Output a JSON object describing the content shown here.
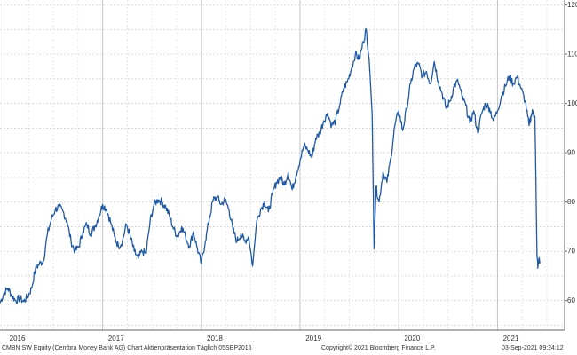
{
  "chart_data": {
    "type": "line",
    "title": "",
    "xlabel": "",
    "ylabel": "",
    "x_tick_labels": [
      "2016",
      "2017",
      "2018",
      "2019",
      "2020",
      "2021"
    ],
    "y_ticks": [
      60,
      70,
      80,
      90,
      100,
      110,
      120
    ],
    "ylim": [
      54,
      121
    ],
    "xlim": [
      2015.96,
      2021.68
    ],
    "grid": true,
    "y_axis_side": "right",
    "series": [
      {
        "name": "",
        "color": "#1f5aa6",
        "points": [
          [
            2015.96,
            59.5
          ],
          [
            2016.0,
            61.5
          ],
          [
            2016.04,
            62.5
          ],
          [
            2016.08,
            61.0
          ],
          [
            2016.12,
            60.0
          ],
          [
            2016.16,
            60.5
          ],
          [
            2016.2,
            59.8
          ],
          [
            2016.24,
            60.8
          ],
          [
            2016.28,
            62.5
          ],
          [
            2016.32,
            66.5
          ],
          [
            2016.36,
            67.5
          ],
          [
            2016.4,
            68.0
          ],
          [
            2016.44,
            73.5
          ],
          [
            2016.48,
            76.5
          ],
          [
            2016.52,
            78.5
          ],
          [
            2016.56,
            79.0
          ],
          [
            2016.6,
            78.0
          ],
          [
            2016.64,
            76.0
          ],
          [
            2016.68,
            72.0
          ],
          [
            2016.72,
            70.0
          ],
          [
            2016.76,
            71.0
          ],
          [
            2016.8,
            74.0
          ],
          [
            2016.84,
            75.5
          ],
          [
            2016.88,
            73.5
          ],
          [
            2016.92,
            75.0
          ],
          [
            2016.96,
            77.0
          ],
          [
            2017.0,
            79.5
          ],
          [
            2017.04,
            78.5
          ],
          [
            2017.08,
            76.0
          ],
          [
            2017.12,
            73.0
          ],
          [
            2017.16,
            71.0
          ],
          [
            2017.2,
            72.0
          ],
          [
            2017.24,
            75.5
          ],
          [
            2017.28,
            73.0
          ],
          [
            2017.32,
            70.0
          ],
          [
            2017.36,
            68.5
          ],
          [
            2017.4,
            70.0
          ],
          [
            2017.44,
            69.5
          ],
          [
            2017.48,
            76.0
          ],
          [
            2017.52,
            79.5
          ],
          [
            2017.56,
            80.5
          ],
          [
            2017.6,
            80.0
          ],
          [
            2017.64,
            79.0
          ],
          [
            2017.68,
            77.0
          ],
          [
            2017.72,
            74.5
          ],
          [
            2017.76,
            73.0
          ],
          [
            2017.8,
            75.0
          ],
          [
            2017.84,
            73.0
          ],
          [
            2017.88,
            71.0
          ],
          [
            2017.92,
            74.0
          ],
          [
            2017.96,
            70.5
          ],
          [
            2018.0,
            67.5
          ],
          [
            2018.04,
            72.0
          ],
          [
            2018.08,
            76.5
          ],
          [
            2018.12,
            80.5
          ],
          [
            2018.16,
            81.0
          ],
          [
            2018.2,
            79.5
          ],
          [
            2018.24,
            80.5
          ],
          [
            2018.28,
            78.5
          ],
          [
            2018.32,
            74.5
          ],
          [
            2018.36,
            72.0
          ],
          [
            2018.4,
            73.5
          ],
          [
            2018.44,
            72.0
          ],
          [
            2018.48,
            73.0
          ],
          [
            2018.52,
            67.0
          ],
          [
            2018.56,
            76.0
          ],
          [
            2018.6,
            78.5
          ],
          [
            2018.64,
            80.0
          ],
          [
            2018.68,
            78.0
          ],
          [
            2018.72,
            81.5
          ],
          [
            2018.76,
            84.0
          ],
          [
            2018.8,
            85.0
          ],
          [
            2018.84,
            83.5
          ],
          [
            2018.88,
            86.0
          ],
          [
            2018.92,
            82.5
          ],
          [
            2018.96,
            85.5
          ],
          [
            2019.0,
            88.5
          ],
          [
            2019.04,
            91.5
          ],
          [
            2019.08,
            90.5
          ],
          [
            2019.12,
            89.0
          ],
          [
            2019.16,
            93.0
          ],
          [
            2019.2,
            94.0
          ],
          [
            2019.24,
            96.5
          ],
          [
            2019.28,
            98.0
          ],
          [
            2019.32,
            95.5
          ],
          [
            2019.36,
            96.5
          ],
          [
            2019.4,
            99.5
          ],
          [
            2019.44,
            103.0
          ],
          [
            2019.48,
            104.5
          ],
          [
            2019.52,
            107.0
          ],
          [
            2019.56,
            110.0
          ],
          [
            2019.6,
            109.0
          ],
          [
            2019.64,
            112.5
          ],
          [
            2019.67,
            115.0
          ],
          [
            2019.7,
            109.0
          ],
          [
            2019.73,
            98.0
          ],
          [
            2019.75,
            70.5
          ],
          [
            2019.77,
            83.0
          ],
          [
            2019.8,
            80.0
          ],
          [
            2019.84,
            86.0
          ],
          [
            2019.88,
            84.0
          ],
          [
            2019.92,
            89.0
          ],
          [
            2019.96,
            95.5
          ],
          [
            2020.0,
            98.5
          ],
          [
            2020.04,
            94.5
          ],
          [
            2020.08,
            99.0
          ],
          [
            2020.12,
            104.0
          ],
          [
            2020.16,
            107.5
          ],
          [
            2020.2,
            108.0
          ],
          [
            2020.24,
            105.5
          ],
          [
            2020.28,
            106.5
          ],
          [
            2020.32,
            104.0
          ],
          [
            2020.36,
            108.5
          ],
          [
            2020.4,
            104.5
          ],
          [
            2020.44,
            102.0
          ],
          [
            2020.48,
            99.0
          ],
          [
            2020.52,
            100.5
          ],
          [
            2020.56,
            103.5
          ],
          [
            2020.6,
            104.5
          ],
          [
            2020.64,
            101.5
          ],
          [
            2020.68,
            99.5
          ],
          [
            2020.72,
            96.0
          ],
          [
            2020.76,
            98.5
          ],
          [
            2020.8,
            94.0
          ],
          [
            2020.84,
            98.0
          ],
          [
            2020.88,
            100.0
          ],
          [
            2020.92,
            99.0
          ],
          [
            2020.96,
            96.5
          ],
          [
            2021.0,
            98.5
          ],
          [
            2021.04,
            101.5
          ],
          [
            2021.08,
            103.5
          ],
          [
            2021.12,
            105.5
          ],
          [
            2021.16,
            104.0
          ],
          [
            2021.2,
            105.5
          ],
          [
            2021.24,
            103.0
          ],
          [
            2021.28,
            100.5
          ],
          [
            2021.32,
            95.5
          ],
          [
            2021.34,
            97.5
          ],
          [
            2021.36,
            98.5
          ],
          [
            2021.38,
            97.0
          ],
          [
            2021.4,
            69.0
          ],
          [
            2021.41,
            66.8
          ],
          [
            2021.42,
            68.5
          ],
          [
            2021.43,
            67.5
          ]
        ]
      }
    ]
  },
  "footer": {
    "left": "CMBN SW Equity (Cembra Money Bank AG) Chart Aktienpräsentation  Täglich 05SEP2016",
    "middle": "Copyright© 2021 Bloomberg Finance L.P.",
    "right": "03-Sep-2021 09:24:12"
  }
}
